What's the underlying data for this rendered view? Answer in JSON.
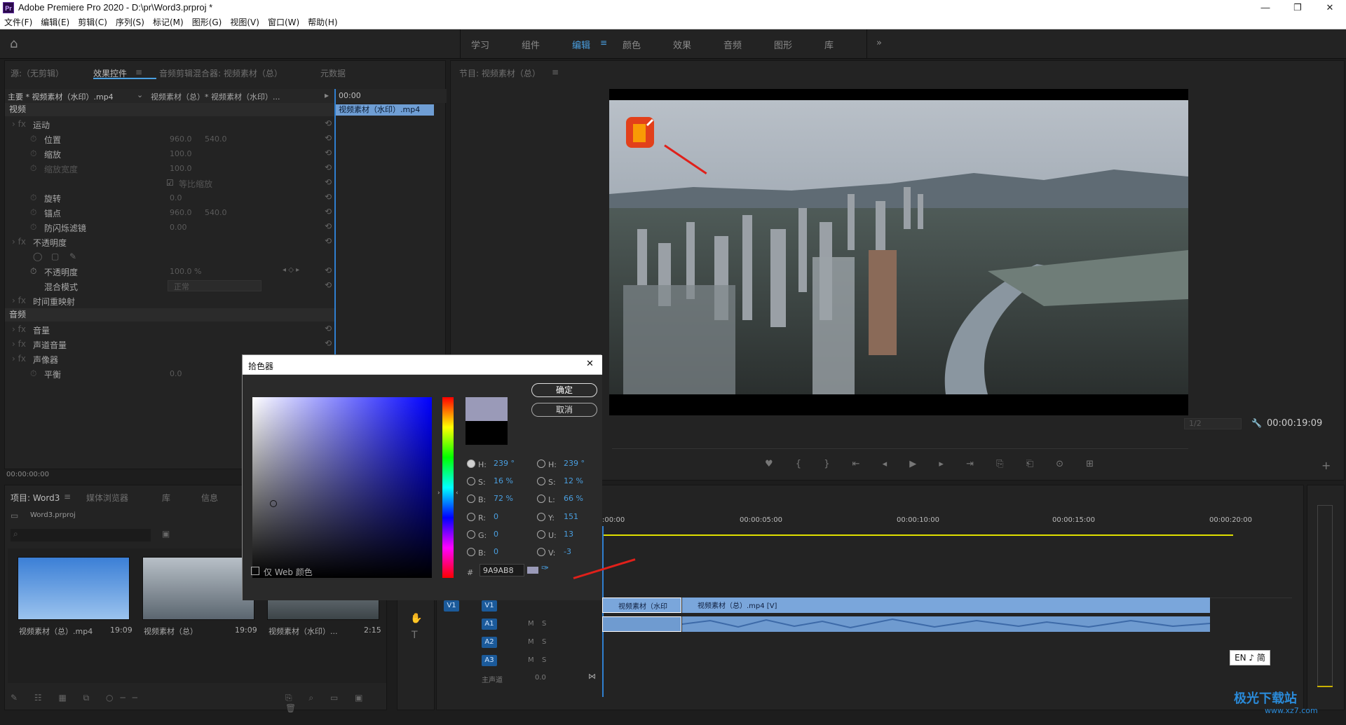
{
  "window": {
    "title": "Adobe Premiere Pro 2020 - D:\\pr\\Word3.prproj *",
    "logo": "Pr",
    "minimize": "—",
    "maximize": "❐",
    "close": "✕"
  },
  "menu": [
    "文件(F)",
    "编辑(E)",
    "剪辑(C)",
    "序列(S)",
    "标记(M)",
    "图形(G)",
    "视图(V)",
    "窗口(W)",
    "帮助(H)"
  ],
  "workspaces": [
    "学习",
    "组件",
    "编辑",
    "颜色",
    "效果",
    "音频",
    "图形",
    "库"
  ],
  "workspace_active": "编辑",
  "workspace_more": "»",
  "source_tabs": [
    "源:（无剪辑）",
    "效果控件",
    "音频剪辑混合器: 视频素材（总）",
    "元数据"
  ],
  "program_tab": "节目: 视频素材（总）",
  "effects": {
    "master": "主要 * 视频素材（水印）.mp4",
    "clip": "视频素材（总）* 视频素材（水印）...",
    "timecode_start": "00:00",
    "clip_bar": "视频素材（水印）.mp4",
    "video_hdr": "视频",
    "motion": "运动",
    "position": {
      "label": "位置",
      "v1": "960.0",
      "v2": "540.0"
    },
    "scale": {
      "label": "缩放",
      "v1": "100.0"
    },
    "scale_width": {
      "label": "缩放宽度",
      "v1": "100.0"
    },
    "uniform": "等比缩放",
    "rotation": {
      "label": "旋转",
      "v1": "0.0"
    },
    "anchor": {
      "label": "锚点",
      "v1": "960.0",
      "v2": "540.0"
    },
    "antiflicker": {
      "label": "防闪烁滤镜",
      "v1": "0.00"
    },
    "opacity_grp": "不透明度",
    "opacity": {
      "label": "不透明度",
      "v1": "100.0 %"
    },
    "blend": {
      "label": "混合模式",
      "v1": "正常"
    },
    "time_remap": "时间重映射",
    "audio_hdr": "音频",
    "volume": "音量",
    "channel_volume": "声道音量",
    "panner": "声像器",
    "balance": {
      "label": "平衡",
      "v1": "0.0"
    },
    "timecode": "00:00:00:00"
  },
  "program": {
    "fit": "1/2",
    "timecode": "00:00:19:09"
  },
  "project": {
    "tabs": [
      "项目: Word3",
      "媒体浏览器",
      "库",
      "信息"
    ],
    "file": "Word3.prproj",
    "items": [
      {
        "name": "视频素材（总）.mp4",
        "dur": "19:09"
      },
      {
        "name": "视频素材（总）",
        "dur": "19:09"
      },
      {
        "name": "视频素材（水印）...",
        "dur": "2:15"
      }
    ]
  },
  "timeline": {
    "ticks": [
      ":00:00",
      "00:00:05:00",
      "00:00:10:00",
      "00:00:15:00",
      "00:00:20:00"
    ],
    "tracks": {
      "v1": "V1",
      "a1": "A1",
      "a2": "A2",
      "a3": "A3",
      "master": "主声道",
      "master_val": "0.0"
    },
    "clip1": "视频素材（水印",
    "clip2": "视频素材（总）.mp4 [V]",
    "mute": "M",
    "solo": "S"
  },
  "color_picker": {
    "title": "拾色器",
    "ok": "确定",
    "cancel": "取消",
    "web_only": "仅 Web 颜色",
    "hex_label": "#",
    "hex": "9A9AB8",
    "hsb": {
      "H": "239 °",
      "S": "16 %",
      "B": "72 %"
    },
    "hsl": {
      "H": "239 °",
      "S": "12 %",
      "L": "66 %"
    },
    "rgb": {
      "R": "0",
      "G": "0",
      "B": "0"
    },
    "yuv": {
      "Y": "151",
      "U": "13",
      "V": "-3"
    },
    "selected_color": "#9a9ab8",
    "hue_color": "#0000ff"
  },
  "ime": "EN ♪ 简",
  "watermark": "极光下载站",
  "watermark_url": "www.xz7.com"
}
